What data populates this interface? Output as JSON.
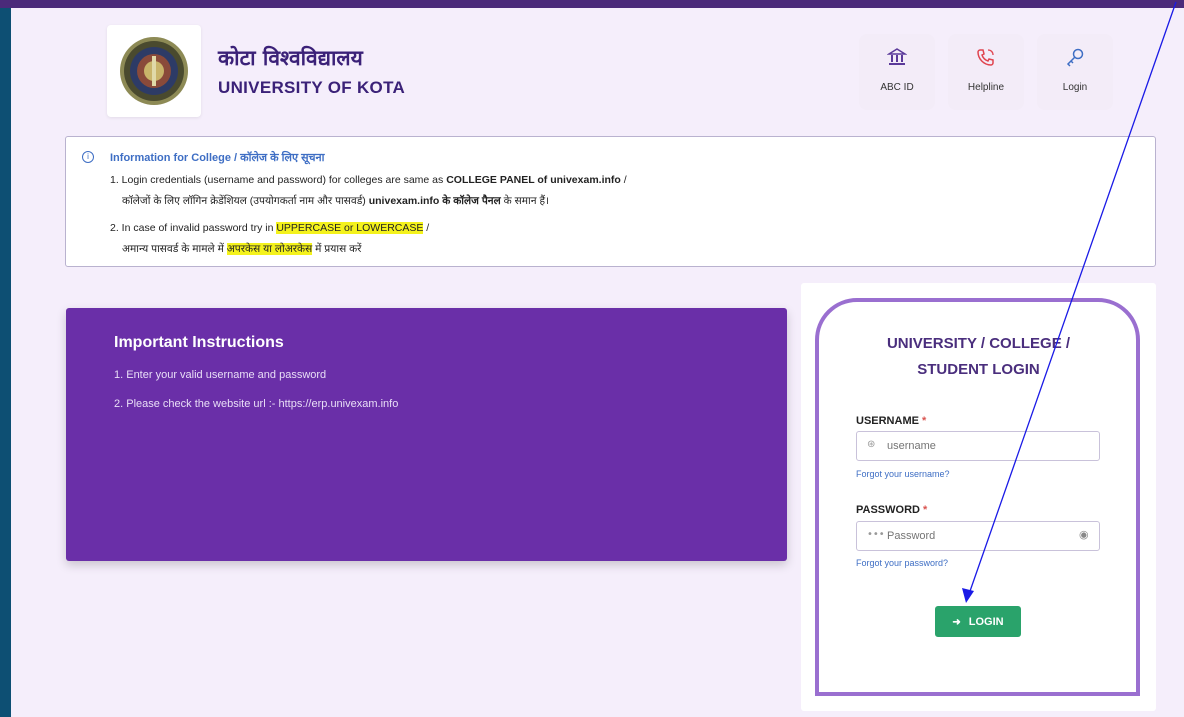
{
  "header": {
    "title_hindi": "कोटा विश्वविद्यालय",
    "title_english": "UNIVERSITY OF KOTA",
    "buttons": [
      {
        "label": "ABC ID",
        "icon": "bank-icon"
      },
      {
        "label": "Helpline",
        "icon": "phone-icon"
      },
      {
        "label": "Login",
        "icon": "key-icon"
      }
    ]
  },
  "info": {
    "title": "Information for College / कॉलेज के लिए सूचना",
    "item1_en_pre": "1. Login credentials (username and password) for colleges are same as ",
    "item1_en_bold": "COLLEGE PANEL of univexam.info",
    "item1_en_post": " /",
    "item1_hi_pre": "कॉलेजों के लिए लॉगिन क्रेडेंशियल (उपयोगकर्ता नाम और पासवर्ड) ",
    "item1_hi_bold": "univexam.info के कॉलेज पैनल",
    "item1_hi_post": " के समान हैं।",
    "item2_en_pre": "2. In case of invalid password try in ",
    "item2_en_hl": "UPPERCASE or LOWERCASE",
    "item2_en_post": " /",
    "item2_hi_pre": "अमान्य पासवर्ड के मामले में ",
    "item2_hi_hl": "अपरकेस या लोअरकेस",
    "item2_hi_post": " में प्रयास करें"
  },
  "instructions": {
    "title": "Important Instructions",
    "items": [
      "1. Enter your valid username and password",
      "2. Please check the website url :- https://erp.univexam.info"
    ]
  },
  "login": {
    "title_line1": "UNIVERSITY / COLLEGE /",
    "title_line2": "STUDENT LOGIN",
    "username_label": "USERNAME",
    "username_placeholder": "username",
    "forgot_username": "Forgot your username?",
    "password_label": "PASSWORD",
    "password_placeholder": "Password",
    "forgot_password": "Forgot your password?",
    "button_label": "LOGIN",
    "required_mark": "*"
  },
  "colors": {
    "accent_purple": "#6a2fa8",
    "frame_purple": "#9a6fd0",
    "login_green": "#2aa36b",
    "link_blue": "#3e6ec4",
    "highlight_yellow": "#f4f21c"
  }
}
